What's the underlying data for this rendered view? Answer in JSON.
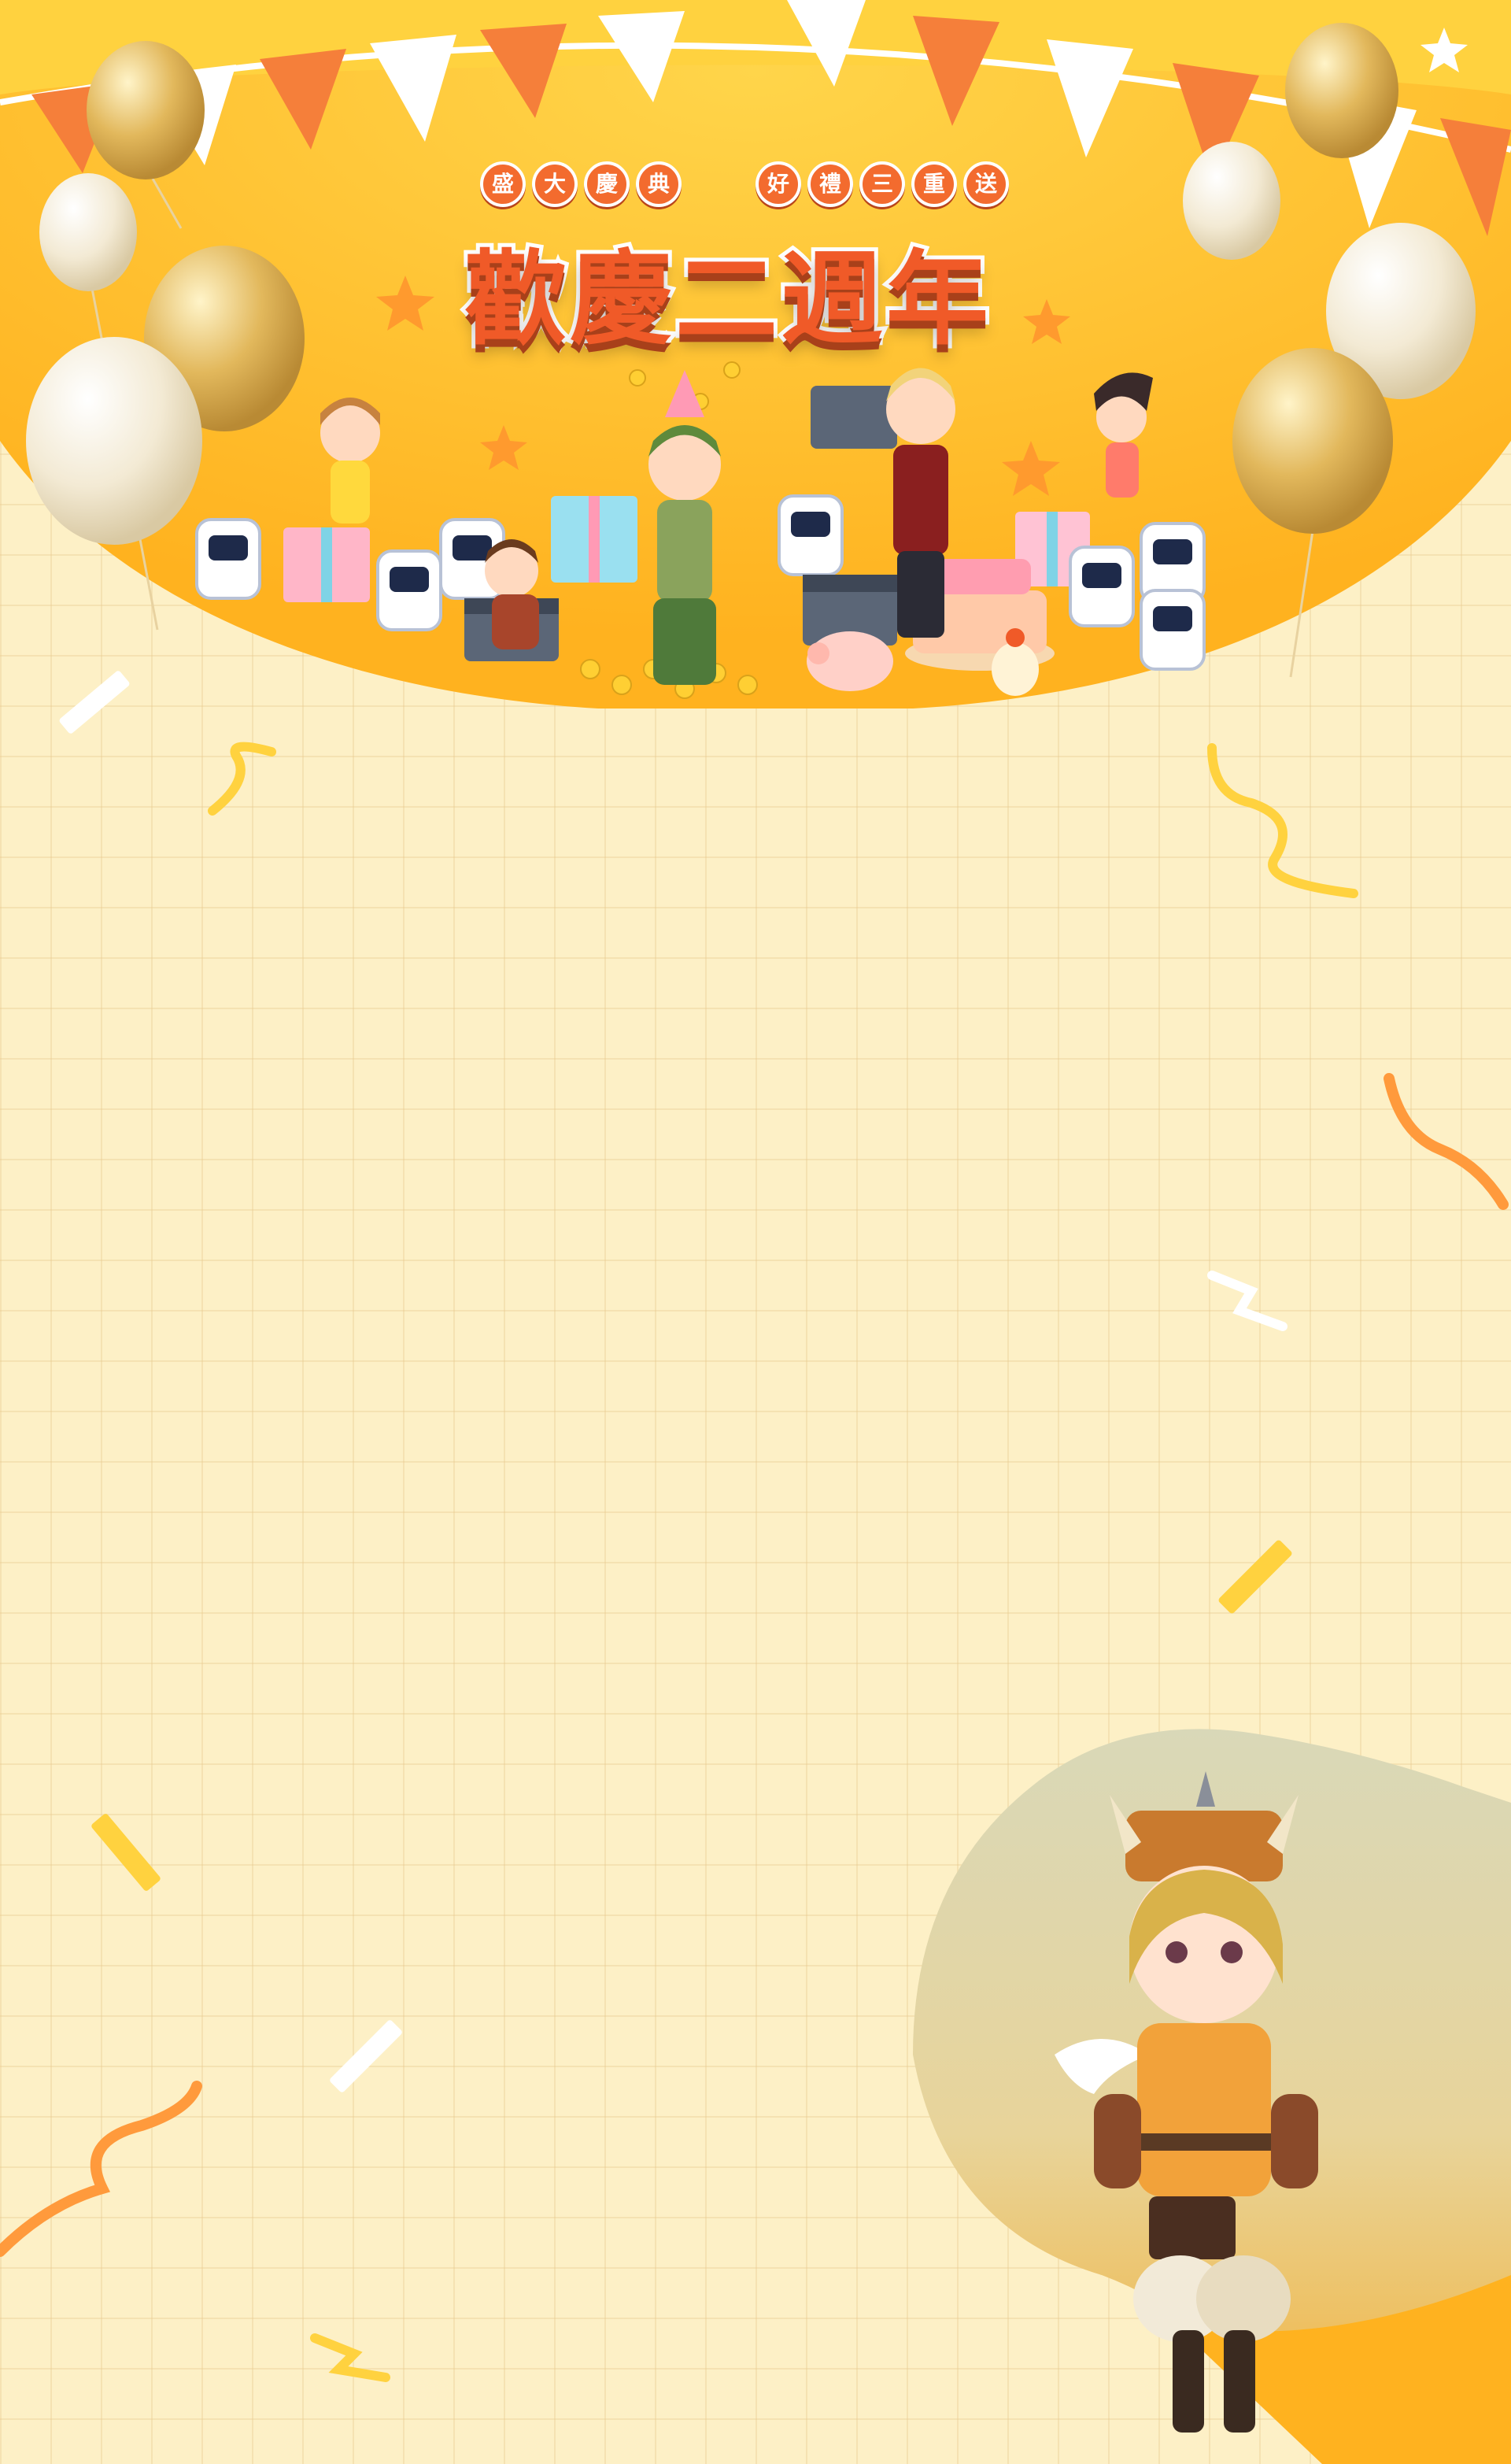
{
  "banner": {
    "tagline_left": [
      "盛",
      "大",
      "慶",
      "典"
    ],
    "tagline_right": [
      "好",
      "禮",
      "三",
      "重",
      "送"
    ],
    "title": "歡慶二週年"
  },
  "colors": {
    "background": "#fdf0c6",
    "grid_line": "#e8cd8e",
    "hero_yellow": "#ffc226",
    "bunting_orange": "#f57f3a",
    "bunting_white": "#ffffff",
    "title_orange": "#f05a28",
    "confetti_yellow": "#ffd23f",
    "confetti_orange": "#ff9a3c"
  },
  "decorations": {
    "icons": [
      "balloon-icon",
      "pennant-icon",
      "star-icon",
      "confetti-icon",
      "gift-box-icon",
      "robot-icon",
      "treasure-chest-icon",
      "cake-icon",
      "pig-icon",
      "chick-icon"
    ]
  }
}
